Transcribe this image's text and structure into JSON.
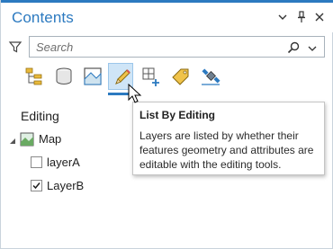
{
  "pane": {
    "title": "Contents",
    "controls": [
      {
        "name": "options-menu-icon",
        "glyph": "▾"
      },
      {
        "name": "auto-hide-pin-icon",
        "glyph": "⊥"
      },
      {
        "name": "close-icon",
        "glyph": "✕"
      }
    ],
    "accent_color": "#2c7ac0"
  },
  "search": {
    "placeholder": "Search",
    "value": ""
  },
  "toolbar": {
    "buttons": [
      {
        "name": "list-by-drawing-order-icon",
        "active": false
      },
      {
        "name": "list-by-data-source-icon",
        "active": false
      },
      {
        "name": "list-by-selection-icon",
        "active": false
      },
      {
        "name": "list-by-editing-icon",
        "active": true
      },
      {
        "name": "list-by-snapping-icon",
        "active": false
      },
      {
        "name": "list-by-labeling-icon",
        "active": false
      },
      {
        "name": "list-by-perspective-imagery-icon",
        "active": false
      }
    ]
  },
  "main": {
    "section_heading": "Editing",
    "tree": {
      "map_label": "Map",
      "layers": [
        {
          "label": "layerA",
          "checked": false
        },
        {
          "label": "LayerB",
          "checked": true
        }
      ]
    }
  },
  "tooltip": {
    "title": "List By Editing",
    "body": "Layers are listed by whether their features geometry and attributes are editable with the editing tools."
  }
}
